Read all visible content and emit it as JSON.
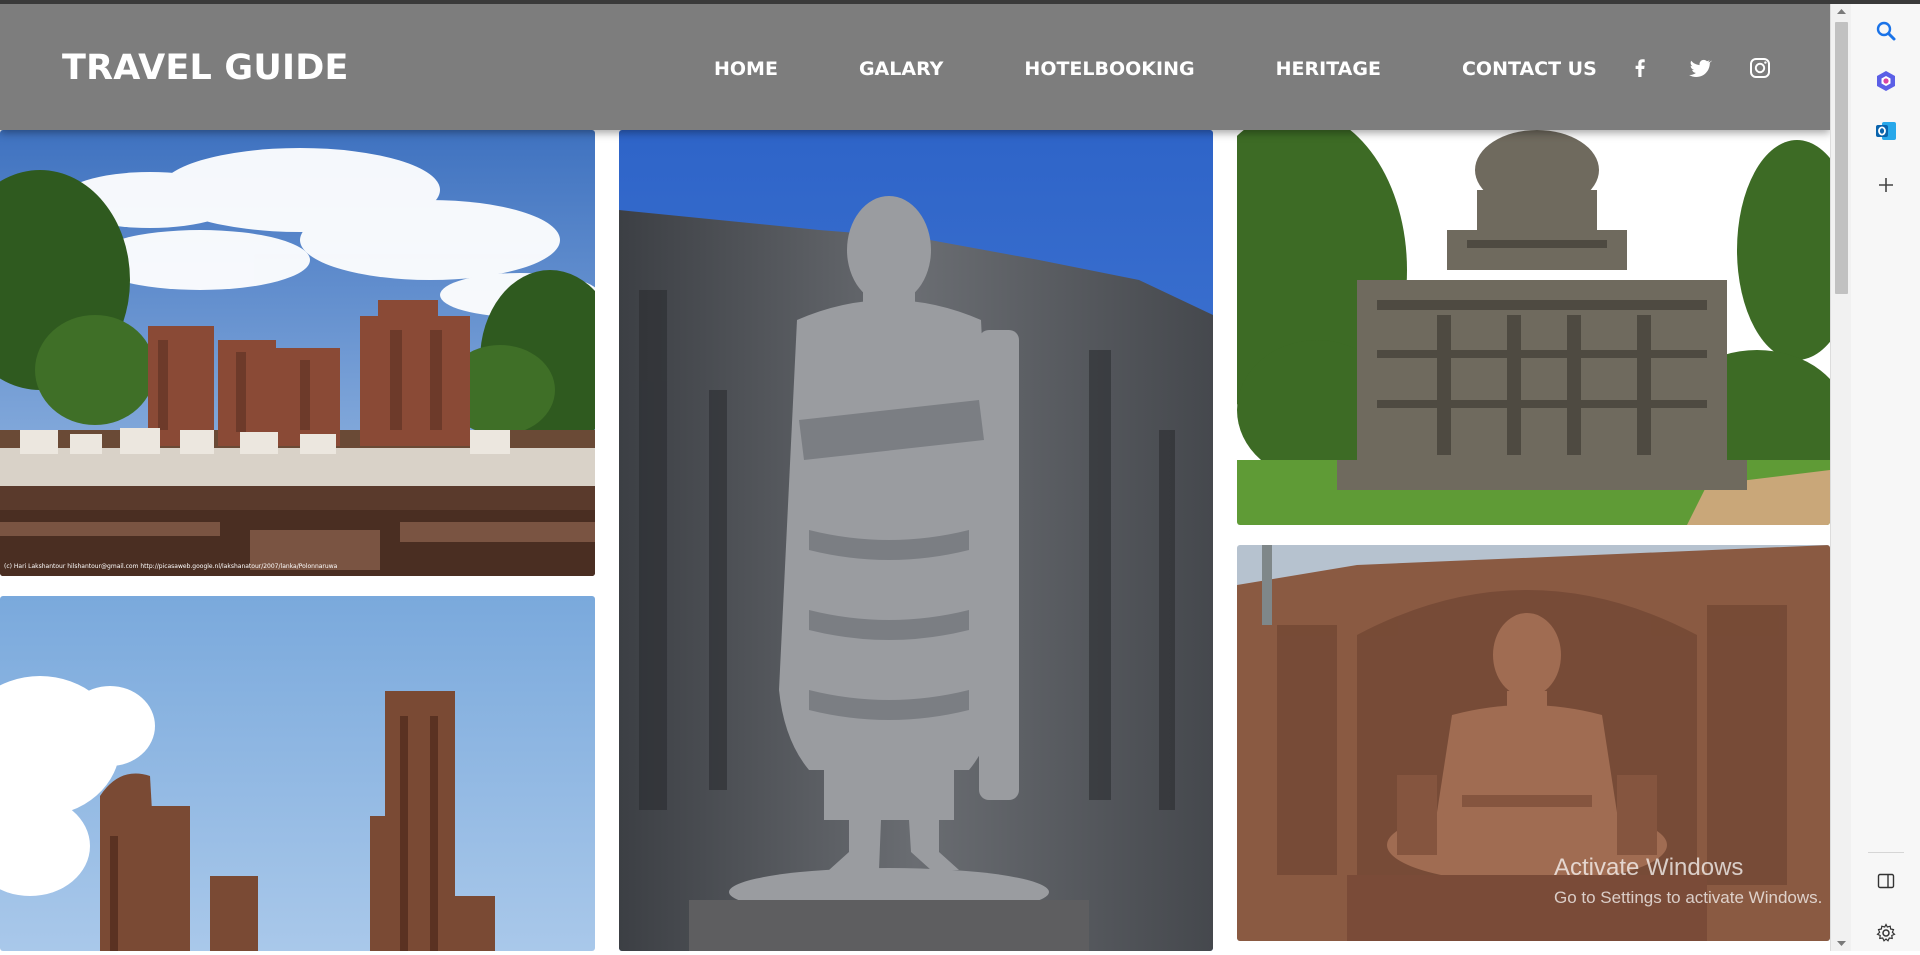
{
  "brand": {
    "title": "TRAVEL GUIDE"
  },
  "nav": {
    "items": [
      {
        "label": "HOME"
      },
      {
        "label": "GALARY"
      },
      {
        "label": "HOTELBOOKING"
      },
      {
        "label": "HERITAGE"
      },
      {
        "label": "CONTACT US"
      }
    ]
  },
  "social": [
    "facebook-icon",
    "twitter-icon",
    "instagram-icon"
  ],
  "gallery": {
    "photos": [
      {
        "subject": "Royal palace ruins",
        "caption": "(c) Hari Lakshantour hilshantour@gmail.com http://picasaweb.google.nl/lakshanatour/2007/lanka/Polonnaruwa"
      },
      {
        "subject": "Standing Buddha statue carved in rock"
      },
      {
        "subject": "Ancient stone shrine"
      },
      {
        "subject": "Brick ruins against blue sky"
      },
      {
        "subject": "Seated Buddha carved in rock"
      }
    ]
  },
  "edge_sidebar": [
    "search-icon",
    "copilot-icon",
    "outlook-icon",
    "add-icon",
    "sidebar-toggle-icon",
    "settings-icon"
  ],
  "watermark": {
    "title": "Activate Windows",
    "subtitle": "Go to Settings to activate Windows."
  },
  "colors": {
    "navbar": "#7d7d7d",
    "text": "#ffffff"
  }
}
